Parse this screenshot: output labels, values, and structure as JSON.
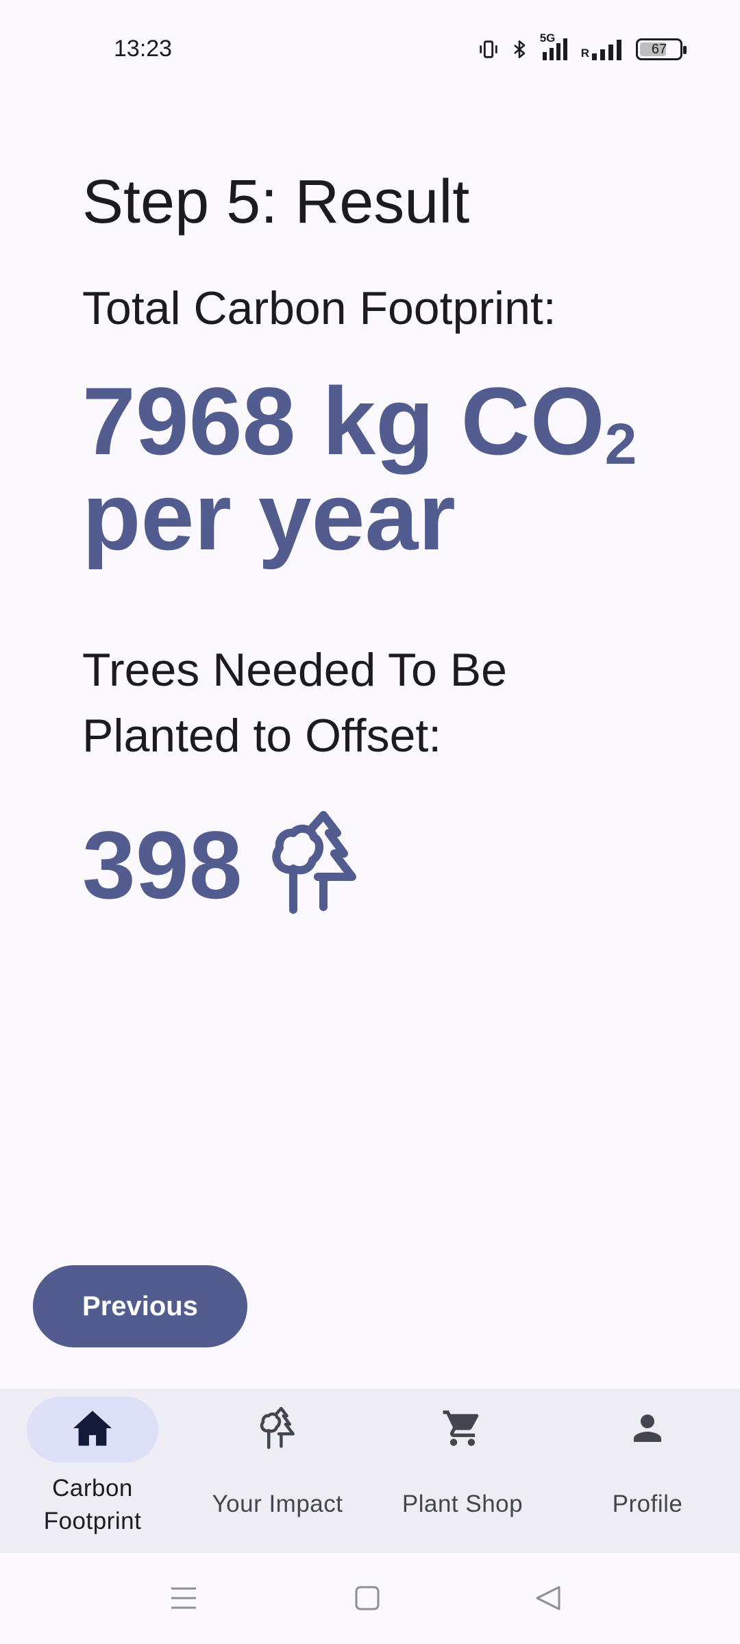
{
  "status_bar": {
    "time": "13:23",
    "battery": "67",
    "network": "5G",
    "roaming": "R",
    "icons": [
      "vibrate-icon",
      "bluetooth-icon",
      "signal-5g-icon",
      "signal-roaming-icon",
      "battery-icon"
    ]
  },
  "result": {
    "step_title": "Step 5: Result",
    "total_label": "Total Carbon Footprint:",
    "footprint_main": "7968 kg CO",
    "footprint_subscript": "2",
    "footprint_period": "per year",
    "trees_label": "Trees Needed To Be Planted to Offset:",
    "trees_count": "398",
    "trees_icon": "trees-icon"
  },
  "actions": {
    "previous_label": "Previous"
  },
  "bottom_nav": {
    "items": [
      {
        "label": "Carbon Footprint",
        "icon": "home-icon",
        "active": true
      },
      {
        "label": "Your Impact",
        "icon": "trees-icon",
        "active": false
      },
      {
        "label": "Plant Shop",
        "icon": "cart-icon",
        "active": false
      },
      {
        "label": "Profile",
        "icon": "person-icon",
        "active": false
      }
    ]
  },
  "system_nav": {
    "icons": [
      "menu-icon",
      "home-square-icon",
      "back-icon"
    ]
  },
  "colors": {
    "accent": "#525C8F",
    "background": "#FBF8FE",
    "nav_background": "#EEEDF3",
    "nav_active_pill": "#DEE0F8",
    "text": "#1B1B21"
  }
}
